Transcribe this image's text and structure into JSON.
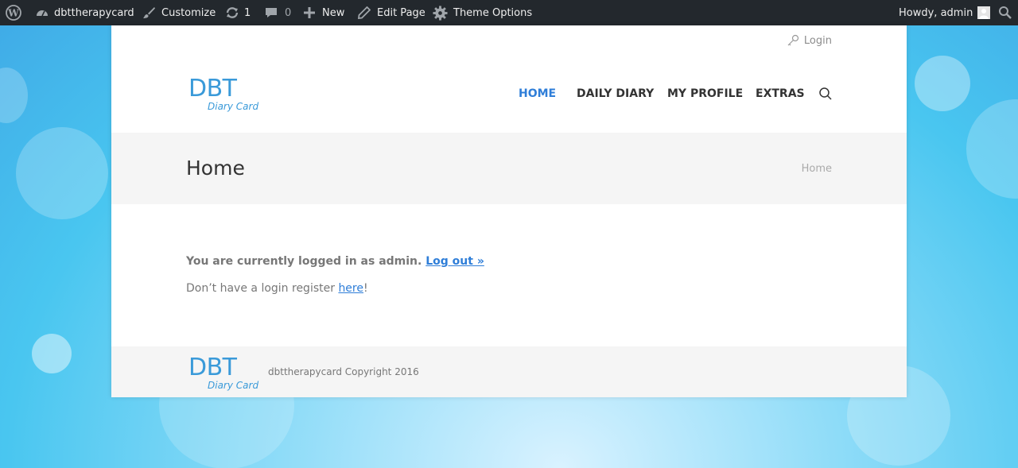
{
  "adminbar": {
    "wp_icon": "wordpress-icon",
    "site_name": "dbttherapycard",
    "customize": "Customize",
    "updates_count": "1",
    "comments_count": "0",
    "new": "New",
    "edit_page": "Edit Page",
    "theme_options": "Theme Options",
    "howdy": "Howdy, admin"
  },
  "header": {
    "login": "Login",
    "logo_main": "DBT",
    "logo_sub": "Diary Card",
    "nav": [
      {
        "label": "HOME",
        "active": true
      },
      {
        "label": "DAILY DIARY",
        "active": false
      },
      {
        "label": "MY PROFILE",
        "active": false
      },
      {
        "label": "EXTRAS",
        "active": false
      }
    ]
  },
  "titlebar": {
    "title": "Home",
    "breadcrumb": "Home"
  },
  "content": {
    "logged_in_text": "You are currently logged in as admin.",
    "logout_link": "Log out »",
    "register_prefix": "Don’t have a login register ",
    "register_link": "here",
    "register_suffix": "!"
  },
  "footer": {
    "logo_main": "DBT",
    "logo_sub": "Diary Card",
    "copyright": "dbttherapycard Copyright 2016"
  },
  "colors": {
    "accent": "#2f7ed8",
    "logo": "#3a9ad9",
    "adminbar_bg": "#23282d",
    "titlebar_bg": "#f5f5f5"
  }
}
